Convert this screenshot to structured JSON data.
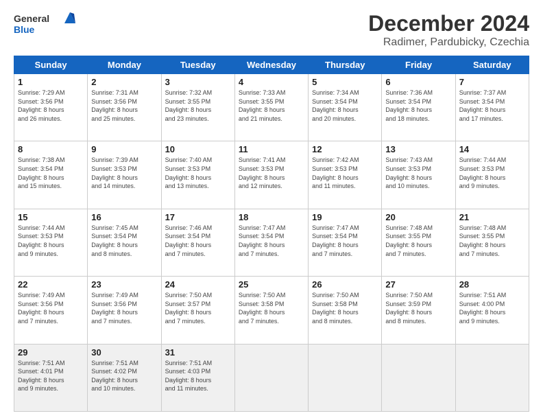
{
  "header": {
    "logo_general": "General",
    "logo_blue": "Blue",
    "title": "December 2024",
    "location": "Radimer, Pardubicky, Czechia"
  },
  "columns": [
    "Sunday",
    "Monday",
    "Tuesday",
    "Wednesday",
    "Thursday",
    "Friday",
    "Saturday"
  ],
  "weeks": [
    [
      {
        "day": "1",
        "info": "Sunrise: 7:29 AM\nSunset: 3:56 PM\nDaylight: 8 hours\nand 26 minutes."
      },
      {
        "day": "2",
        "info": "Sunrise: 7:31 AM\nSunset: 3:56 PM\nDaylight: 8 hours\nand 25 minutes."
      },
      {
        "day": "3",
        "info": "Sunrise: 7:32 AM\nSunset: 3:55 PM\nDaylight: 8 hours\nand 23 minutes."
      },
      {
        "day": "4",
        "info": "Sunrise: 7:33 AM\nSunset: 3:55 PM\nDaylight: 8 hours\nand 21 minutes."
      },
      {
        "day": "5",
        "info": "Sunrise: 7:34 AM\nSunset: 3:54 PM\nDaylight: 8 hours\nand 20 minutes."
      },
      {
        "day": "6",
        "info": "Sunrise: 7:36 AM\nSunset: 3:54 PM\nDaylight: 8 hours\nand 18 minutes."
      },
      {
        "day": "7",
        "info": "Sunrise: 7:37 AM\nSunset: 3:54 PM\nDaylight: 8 hours\nand 17 minutes."
      }
    ],
    [
      {
        "day": "8",
        "info": "Sunrise: 7:38 AM\nSunset: 3:54 PM\nDaylight: 8 hours\nand 15 minutes."
      },
      {
        "day": "9",
        "info": "Sunrise: 7:39 AM\nSunset: 3:53 PM\nDaylight: 8 hours\nand 14 minutes."
      },
      {
        "day": "10",
        "info": "Sunrise: 7:40 AM\nSunset: 3:53 PM\nDaylight: 8 hours\nand 13 minutes."
      },
      {
        "day": "11",
        "info": "Sunrise: 7:41 AM\nSunset: 3:53 PM\nDaylight: 8 hours\nand 12 minutes."
      },
      {
        "day": "12",
        "info": "Sunrise: 7:42 AM\nSunset: 3:53 PM\nDaylight: 8 hours\nand 11 minutes."
      },
      {
        "day": "13",
        "info": "Sunrise: 7:43 AM\nSunset: 3:53 PM\nDaylight: 8 hours\nand 10 minutes."
      },
      {
        "day": "14",
        "info": "Sunrise: 7:44 AM\nSunset: 3:53 PM\nDaylight: 8 hours\nand 9 minutes."
      }
    ],
    [
      {
        "day": "15",
        "info": "Sunrise: 7:44 AM\nSunset: 3:53 PM\nDaylight: 8 hours\nand 9 minutes."
      },
      {
        "day": "16",
        "info": "Sunrise: 7:45 AM\nSunset: 3:54 PM\nDaylight: 8 hours\nand 8 minutes."
      },
      {
        "day": "17",
        "info": "Sunrise: 7:46 AM\nSunset: 3:54 PM\nDaylight: 8 hours\nand 7 minutes."
      },
      {
        "day": "18",
        "info": "Sunrise: 7:47 AM\nSunset: 3:54 PM\nDaylight: 8 hours\nand 7 minutes."
      },
      {
        "day": "19",
        "info": "Sunrise: 7:47 AM\nSunset: 3:54 PM\nDaylight: 8 hours\nand 7 minutes."
      },
      {
        "day": "20",
        "info": "Sunrise: 7:48 AM\nSunset: 3:55 PM\nDaylight: 8 hours\nand 7 minutes."
      },
      {
        "day": "21",
        "info": "Sunrise: 7:48 AM\nSunset: 3:55 PM\nDaylight: 8 hours\nand 7 minutes."
      }
    ],
    [
      {
        "day": "22",
        "info": "Sunrise: 7:49 AM\nSunset: 3:56 PM\nDaylight: 8 hours\nand 7 minutes."
      },
      {
        "day": "23",
        "info": "Sunrise: 7:49 AM\nSunset: 3:56 PM\nDaylight: 8 hours\nand 7 minutes."
      },
      {
        "day": "24",
        "info": "Sunrise: 7:50 AM\nSunset: 3:57 PM\nDaylight: 8 hours\nand 7 minutes."
      },
      {
        "day": "25",
        "info": "Sunrise: 7:50 AM\nSunset: 3:58 PM\nDaylight: 8 hours\nand 7 minutes."
      },
      {
        "day": "26",
        "info": "Sunrise: 7:50 AM\nSunset: 3:58 PM\nDaylight: 8 hours\nand 8 minutes."
      },
      {
        "day": "27",
        "info": "Sunrise: 7:50 AM\nSunset: 3:59 PM\nDaylight: 8 hours\nand 8 minutes."
      },
      {
        "day": "28",
        "info": "Sunrise: 7:51 AM\nSunset: 4:00 PM\nDaylight: 8 hours\nand 9 minutes."
      }
    ],
    [
      {
        "day": "29",
        "info": "Sunrise: 7:51 AM\nSunset: 4:01 PM\nDaylight: 8 hours\nand 9 minutes."
      },
      {
        "day": "30",
        "info": "Sunrise: 7:51 AM\nSunset: 4:02 PM\nDaylight: 8 hours\nand 10 minutes."
      },
      {
        "day": "31",
        "info": "Sunrise: 7:51 AM\nSunset: 4:03 PM\nDaylight: 8 hours\nand 11 minutes."
      },
      {
        "day": "",
        "info": ""
      },
      {
        "day": "",
        "info": ""
      },
      {
        "day": "",
        "info": ""
      },
      {
        "day": "",
        "info": ""
      }
    ]
  ]
}
